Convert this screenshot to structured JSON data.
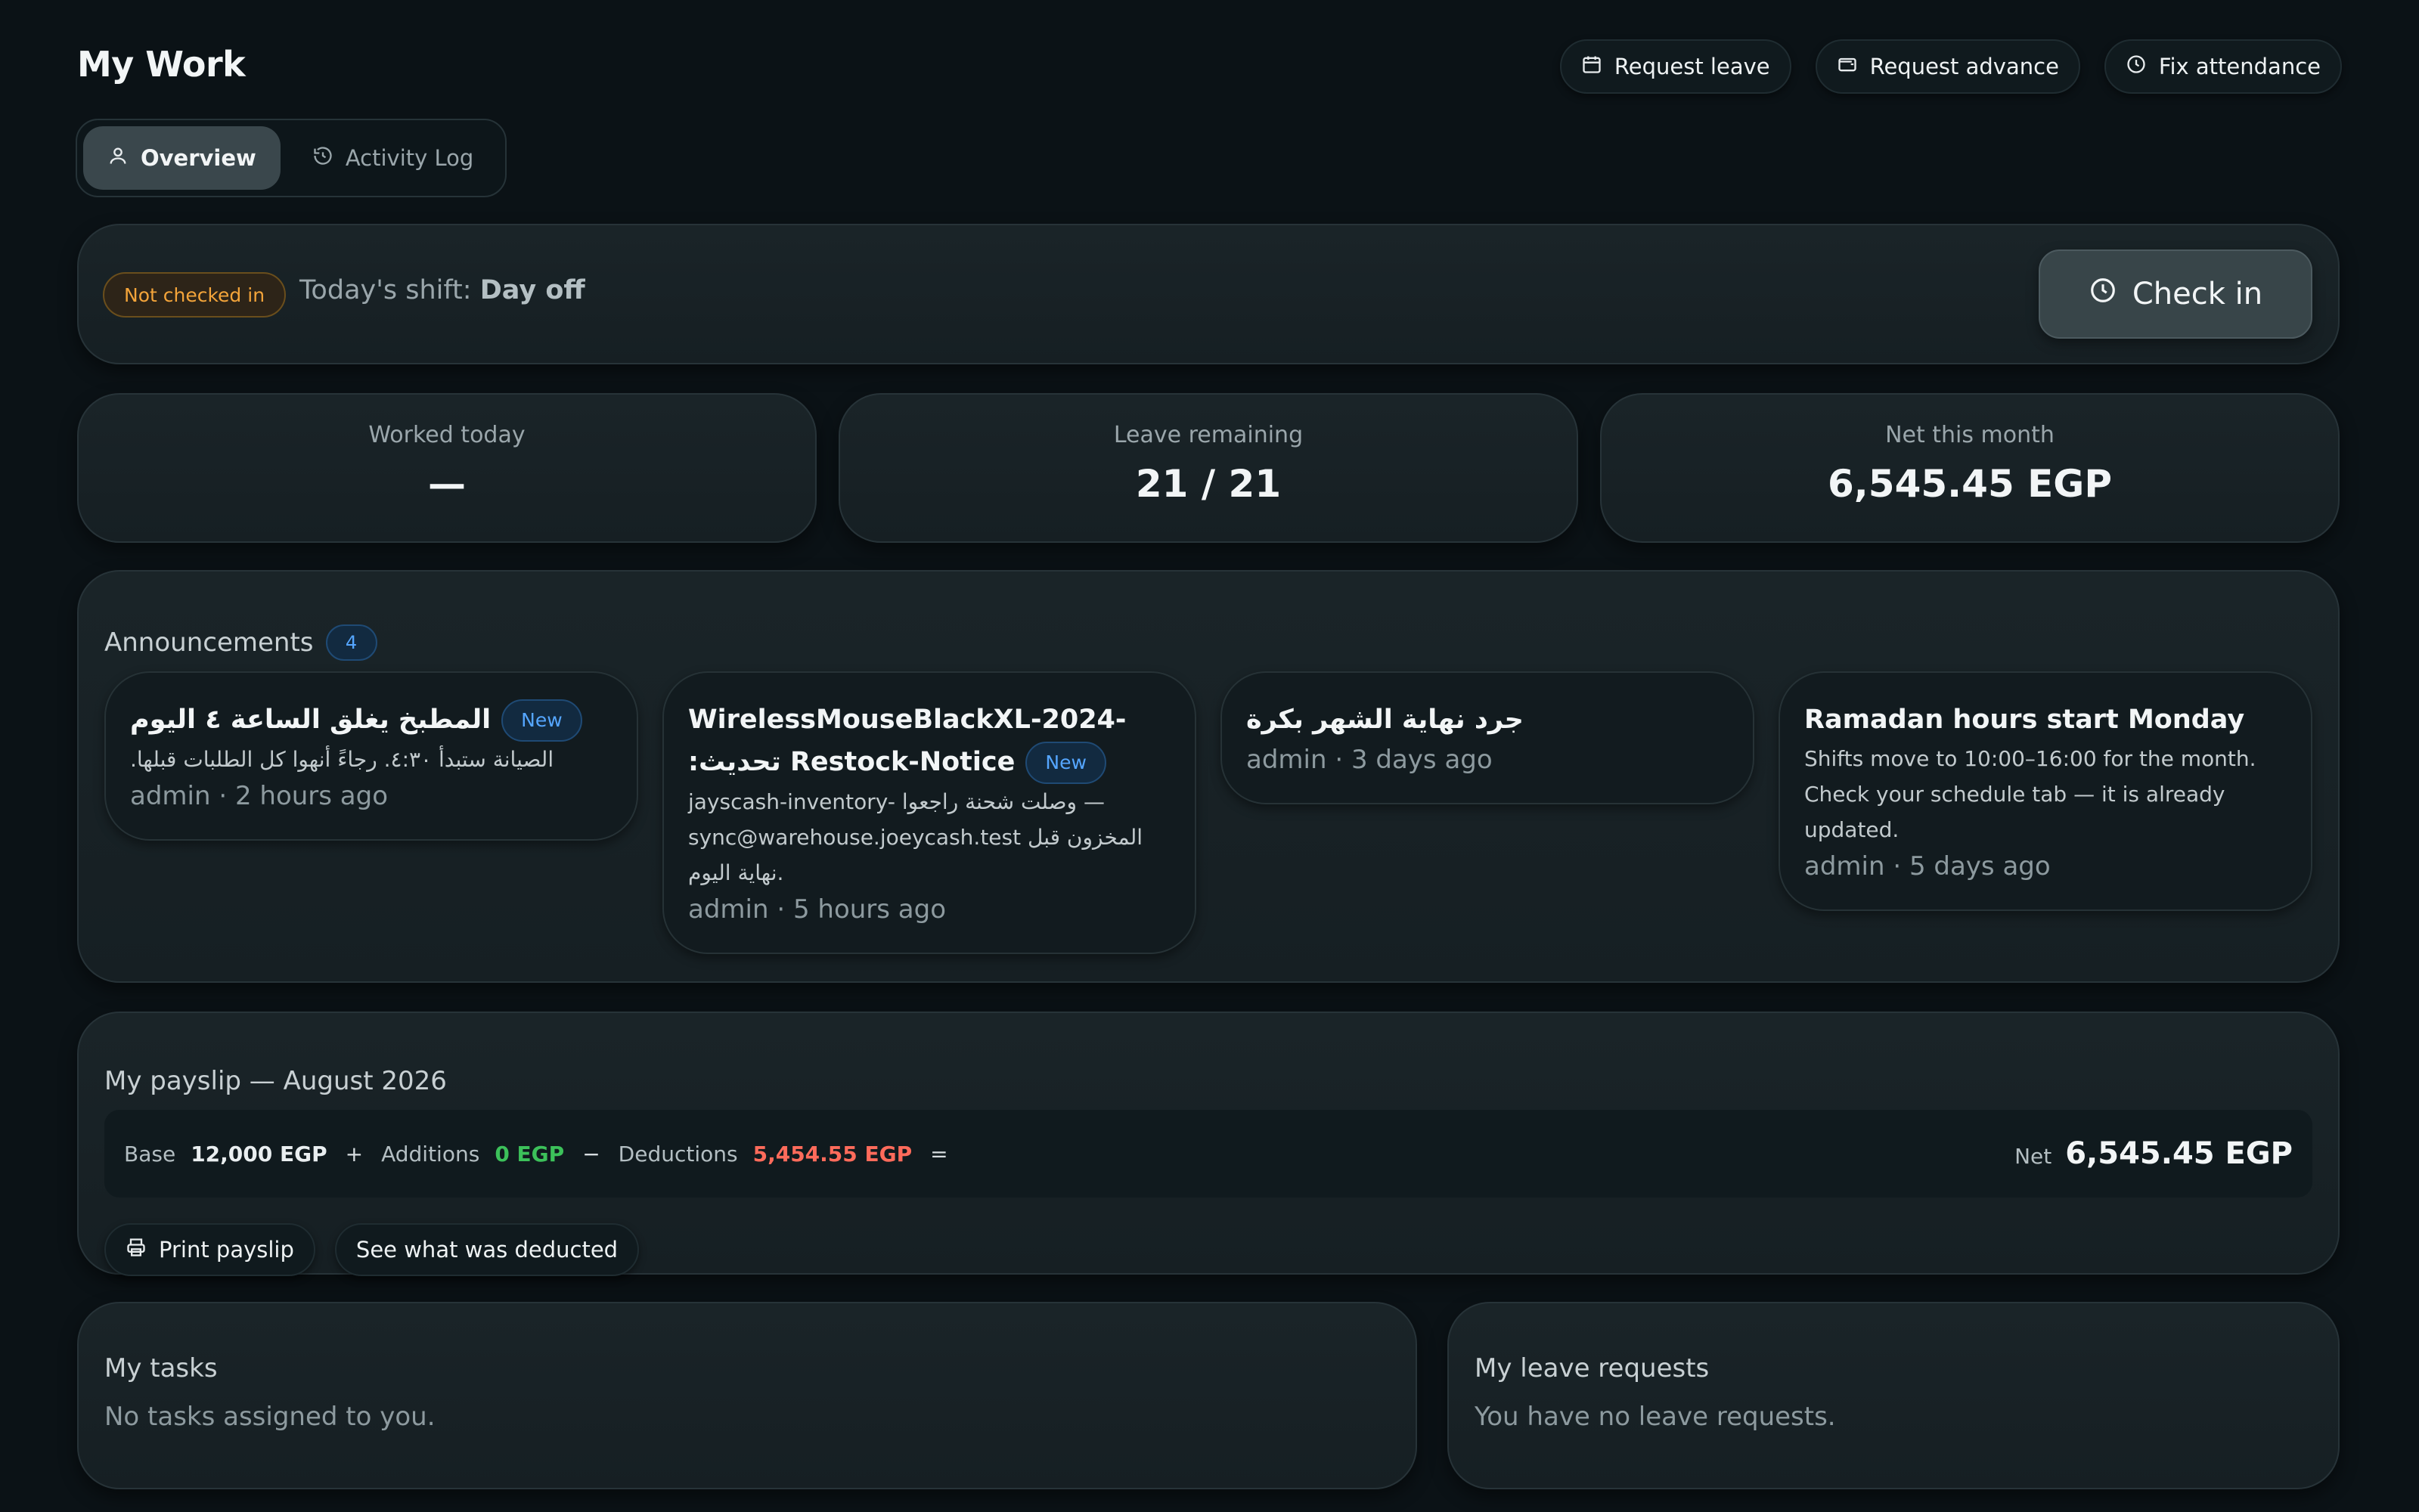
{
  "header": {
    "title": "My Work",
    "actions": [
      {
        "label": "Request leave",
        "icon": "calendar-icon"
      },
      {
        "label": "Request advance",
        "icon": "wallet-icon"
      },
      {
        "label": "Fix attendance",
        "icon": "clock-icon"
      }
    ]
  },
  "tabs": [
    {
      "label": "Overview",
      "icon": "user-icon",
      "active": true
    },
    {
      "label": "Activity Log",
      "icon": "history-icon",
      "active": false
    }
  ],
  "status": {
    "badge": "Not checked in",
    "shift_prefix": "Today's shift:",
    "shift_value": "Day off",
    "checkin_label": "Check in"
  },
  "stats": [
    {
      "label": "Worked today",
      "value": "—"
    },
    {
      "label": "Leave remaining",
      "value": "21 / 21"
    },
    {
      "label": "Net this month",
      "value": "6,545.45 EGP"
    }
  ],
  "announcements": {
    "title": "Announcements",
    "count": "4",
    "items": [
      {
        "title": "المطبخ يغلق الساعة ٤ اليوم",
        "new": "New",
        "body": "الصيانة ستبدأ ٤:٣٠. رجاءً أنهوا كل الطلبات قبلها.",
        "meta": "admin · 2 hours ago"
      },
      {
        "title": "WirelessMouseBlackXL-2024- :تحديث Restock-Notice",
        "new": "New",
        "body": "jayscash-inventory- وصلت شحنة راجعوا — sync@warehouse.joeycash.test المخزون قبل نهاية اليوم.",
        "meta": "admin · 5 hours ago"
      },
      {
        "title": "جرد نهاية الشهر بكرة",
        "new": "",
        "body": "",
        "meta": "admin · 3 days ago"
      },
      {
        "title": "Ramadan hours start Monday",
        "new": "",
        "body": "Shifts move to 10:00–16:00 for the month. Check your schedule tab — it is already updated.",
        "meta": "admin · 5 days ago"
      }
    ]
  },
  "payslip": {
    "title": "My payslip — August 2026",
    "base_label": "Base",
    "base_value": "12,000 EGP",
    "plus": "+",
    "additions_label": "Additions",
    "additions_value": "0 EGP",
    "minus": "−",
    "deductions_label": "Deductions",
    "deductions_value": "5,454.55 EGP",
    "equals": "=",
    "net_label": "Net",
    "net_value": "6,545.45 EGP",
    "print_label": "Print payslip",
    "deducted_label": "See what was deducted"
  },
  "tasks": {
    "title": "My tasks",
    "empty": "No tasks assigned to you."
  },
  "leaves": {
    "title": "My leave requests",
    "empty": "You have no leave requests."
  },
  "colors": {
    "background": "#0b1216",
    "card": "#1a2428",
    "warning": "#f3a43a",
    "info": "#55a6ff",
    "positive": "#3cc15a",
    "negative": "#ff6b5b"
  }
}
